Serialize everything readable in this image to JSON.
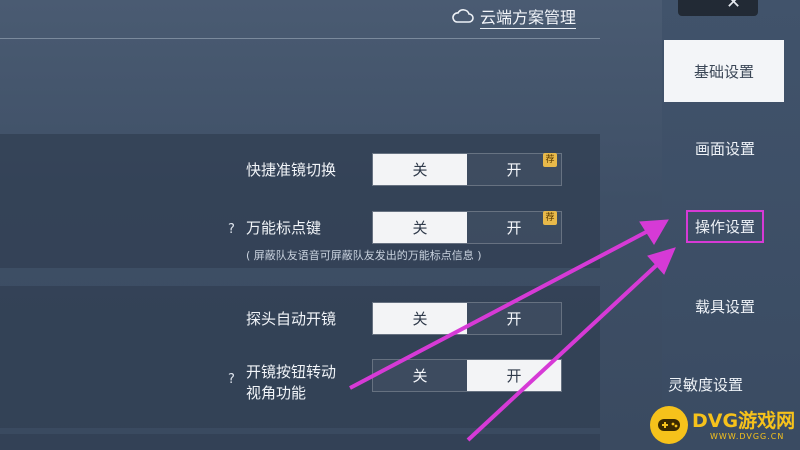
{
  "header": {
    "cloud_label": "云端方案管理",
    "cloud_icon": "cloud-icon"
  },
  "settings": {
    "panel1": {
      "quick_scope": {
        "label": "快捷准镜切换",
        "off": "关",
        "on": "开",
        "selected": "off",
        "badge": "荐"
      },
      "universal_marker": {
        "label": "万能标点键",
        "help": "?",
        "off": "关",
        "on": "开",
        "selected": "off",
        "badge": "荐",
        "hint": "( 屏蔽队友语音可屏蔽队友发出的万能标点信息 )"
      }
    },
    "panel2": {
      "peek_auto_scope": {
        "label": "探头自动开镜",
        "off": "关",
        "on": "开",
        "selected": "off"
      },
      "scope_button_turn": {
        "label_line1": "开镜按钮转动",
        "label_line2": "视角功能",
        "help": "?",
        "off": "关",
        "on": "开",
        "selected": "on"
      }
    }
  },
  "sidebar": {
    "items": [
      {
        "label": "基础设置",
        "active": true
      },
      {
        "label": "画面设置",
        "active": false
      },
      {
        "label": "操作设置",
        "active": false,
        "highlighted": true
      },
      {
        "label": "载具设置",
        "active": false
      },
      {
        "label": "灵敏度设置",
        "active": false
      }
    ]
  },
  "watermark": {
    "brand": "DVG游戏网",
    "url": "WWW.DVGG.CN"
  },
  "colors": {
    "annotation": "#d63ad6",
    "toggle_active_bg": "#f3f4f6",
    "badge": "#e8b94a",
    "watermark": "#f6c21b"
  }
}
